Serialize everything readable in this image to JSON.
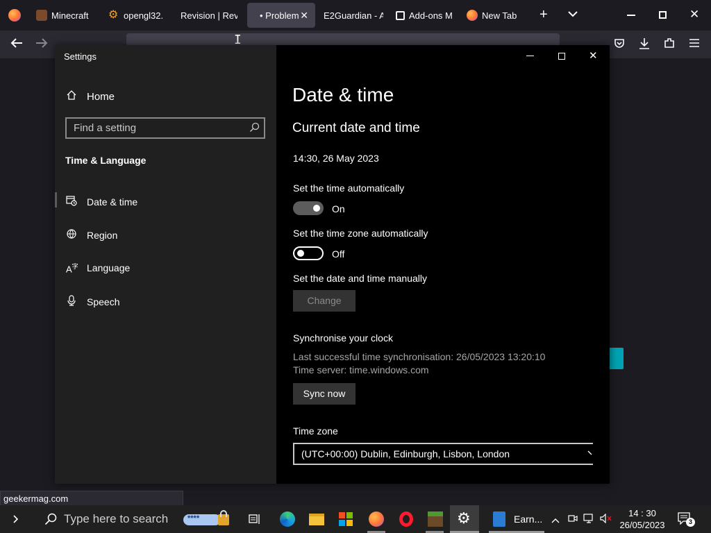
{
  "browser": {
    "tabs": [
      {
        "label": "Minecraft",
        "icon": "minecraft-icon",
        "active": false
      },
      {
        "label": "opengl32.",
        "icon": "gear-icon",
        "active": false
      },
      {
        "label": "Revision | Revi",
        "icon": "",
        "active": false
      },
      {
        "label": "• Problem",
        "icon": "",
        "active": true
      },
      {
        "label": "E2Guardian - A",
        "icon": "",
        "active": false
      },
      {
        "label": "Add-ons M",
        "icon": "puzzle-icon",
        "active": false
      },
      {
        "label": "New Tab",
        "icon": "firefox-icon",
        "active": false
      }
    ],
    "new_tab_symbol": "+",
    "status_url": "geekermag.com"
  },
  "settings": {
    "window_title": "Settings",
    "sidebar": {
      "home_label": "Home",
      "search_placeholder": "Find a setting",
      "category": "Time & Language",
      "items": [
        {
          "label": "Date & time",
          "icon": "calendar-clock-icon"
        },
        {
          "label": "Region",
          "icon": "globe-icon"
        },
        {
          "label": "Language",
          "icon": "language-icon"
        },
        {
          "label": "Speech",
          "icon": "microphone-icon"
        }
      ]
    },
    "main": {
      "page_title": "Date & time",
      "section_title": "Current date and time",
      "current_datetime": "14:30, 26 May 2023",
      "auto_time_label": "Set the time automatically",
      "auto_time_state": "On",
      "auto_tz_label": "Set the time zone automatically",
      "auto_tz_state": "Off",
      "manual_label": "Set the date and time manually",
      "change_button": "Change",
      "sync_title": "Synchronise your clock",
      "last_sync": "Last successful time synchronisation: 26/05/2023 13:20:10",
      "time_server": "Time server: time.windows.com",
      "sync_button": "Sync now",
      "timezone_label": "Time zone",
      "timezone_value": "(UTC+00:00) Dublin, Edinburgh, Lisbon, London"
    }
  },
  "taskbar": {
    "search_placeholder": "Type here to search",
    "app_label": "Earn...",
    "time": "14 : 30",
    "date": "26/05/2023",
    "notification_count": "3"
  },
  "colors": {
    "accent_teal": "#00a4b4",
    "firefox_orange": "#ff7139",
    "opera_red": "#ff1b2d"
  }
}
